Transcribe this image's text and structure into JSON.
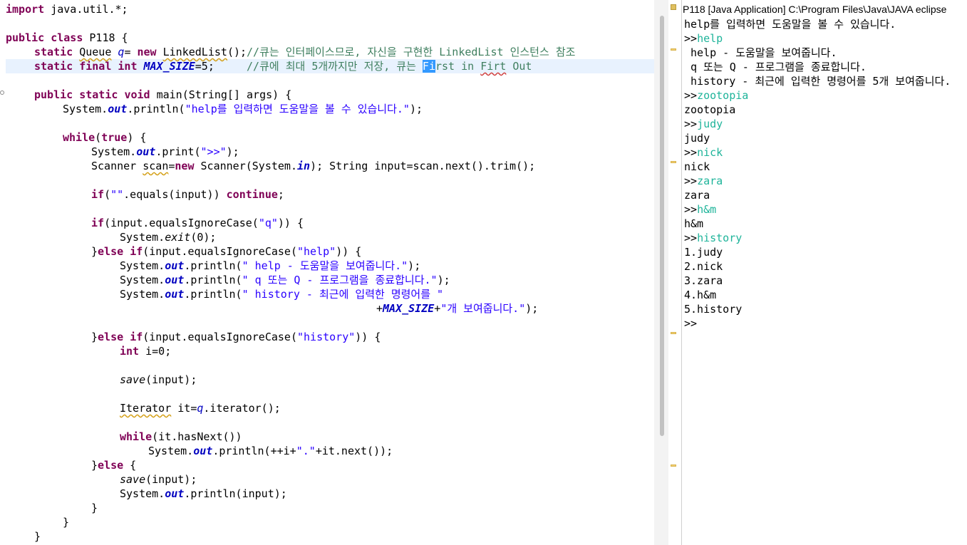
{
  "editor": {
    "lines": [
      "import java.util.*;",
      "public class P118 {",
      "static Queue q= new LinkedList();//큐는 인터페이스므로, 자신을 구현한 LinkedList 인스턴스 참조",
      "static final int MAX_SIZE=5;     //큐에 최대 5개까지만 저장, 큐는 First in Firt Out",
      "public static void main(String[] args) {",
      "System.out.println(\"help를 입력하면 도움말을 볼 수 있습니다.\");",
      "while(true) {",
      "System.out.print(\">>\");",
      "Scanner scan=new Scanner(System.in); String input=scan.next().trim();",
      "if(\"\".equals(input)) continue;",
      "if(input.equalsIgnoreCase(\"q\")) {",
      "System.exit(0);",
      "}else if(input.equalsIgnoreCase(\"help\")) {",
      "System.out.println(\" help - 도움말을 보여줍니다.\");",
      "System.out.println(\" q 또는 Q - 프로그램을 종료합니다.\");",
      "System.out.println(\" history - 최근에 입력한 명령어를 \"",
      "+MAX_SIZE+\"개 보여줍니다.\");",
      "}else if(input.equalsIgnoreCase(\"history\")) {",
      "int i=0;",
      "save(input);",
      "Iterator it=q.iterator();",
      "while(it.hasNext())",
      "System.out.println(++i+\".\"+it.next());",
      "}else {",
      "save(input);",
      "System.out.println(input);",
      "}",
      "}",
      "}"
    ]
  },
  "console": {
    "title": "P118 [Java Application] C:\\Program Files\\Java\\JAVA eclipse",
    "lines": [
      {
        "text": "help를 입력하면 도움말을 볼 수 있습니다.",
        "type": "output"
      },
      {
        "text": ">>",
        "type": "prompt",
        "input": "help"
      },
      {
        "text": " help - 도움말을 보여줍니다.",
        "type": "output"
      },
      {
        "text": " q 또는 Q - 프로그램을 종료합니다.",
        "type": "output"
      },
      {
        "text": " history - 최근에 입력한 명령어를 5개 보여줍니다.",
        "type": "output"
      },
      {
        "text": ">>",
        "type": "prompt",
        "input": "zootopia"
      },
      {
        "text": "zootopia",
        "type": "output"
      },
      {
        "text": ">>",
        "type": "prompt",
        "input": "judy"
      },
      {
        "text": "judy",
        "type": "output"
      },
      {
        "text": ">>",
        "type": "prompt",
        "input": "nick"
      },
      {
        "text": "nick",
        "type": "output"
      },
      {
        "text": ">>",
        "type": "prompt",
        "input": "zara"
      },
      {
        "text": "zara",
        "type": "output"
      },
      {
        "text": ">>",
        "type": "prompt",
        "input": "h&m"
      },
      {
        "text": "h&m",
        "type": "output"
      },
      {
        "text": ">>",
        "type": "prompt",
        "input": "history"
      },
      {
        "text": "1.judy",
        "type": "output"
      },
      {
        "text": "2.nick",
        "type": "output"
      },
      {
        "text": "3.zara",
        "type": "output"
      },
      {
        "text": "4.h&m",
        "type": "output"
      },
      {
        "text": "5.history",
        "type": "output"
      },
      {
        "text": ">>",
        "type": "prompt",
        "input": ""
      }
    ]
  },
  "colors": {
    "keyword": "#7f0055",
    "string": "#2a00ff",
    "comment": "#3f7f5f",
    "field": "#0000c0",
    "console_input": "#1eb49a",
    "current_line": "#e8f2fe",
    "selection": "#3399ff"
  }
}
